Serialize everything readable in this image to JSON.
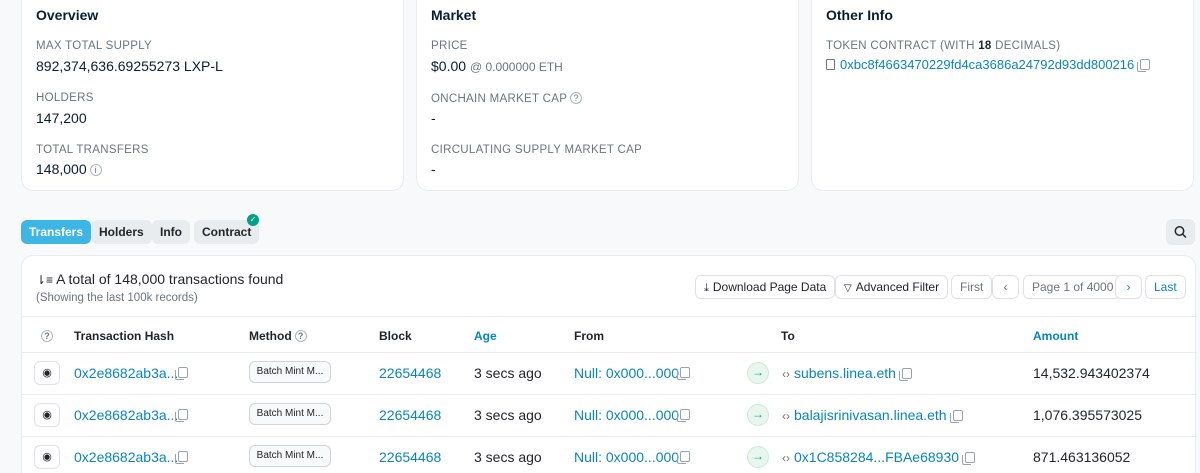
{
  "overview": {
    "title": "Overview",
    "max_supply_label": "MAX TOTAL SUPPLY",
    "max_supply_value": "892,374,636.69255273 LXP-L",
    "holders_label": "HOLDERS",
    "holders_value": "147,200",
    "transfers_label": "TOTAL TRANSFERS",
    "transfers_value": "148,000"
  },
  "market": {
    "title": "Market",
    "price_label": "PRICE",
    "price_value": "$0.00",
    "price_eth": "@ 0.000000 ETH",
    "onchain_cap_label": "ONCHAIN MARKET CAP",
    "onchain_cap_value": "-",
    "circ_cap_label": "CIRCULATING SUPPLY MARKET CAP",
    "circ_cap_value": "-"
  },
  "other_info": {
    "title": "Other Info",
    "contract_label_pre": "TOKEN CONTRACT (WITH ",
    "contract_label_decimals": "18",
    "contract_label_post": " DECIMALS)",
    "contract_address": "0xbc8f4663470229fd4ca3686a24792d93dd800216"
  },
  "tabs": [
    {
      "label": "Transfers",
      "active": true
    },
    {
      "label": "Holders",
      "active": false
    },
    {
      "label": "Info",
      "active": false
    },
    {
      "label": "Contract",
      "active": false
    }
  ],
  "summary": {
    "text": "A total of 148,000 transactions found",
    "sub": "(Showing the last 100k records)"
  },
  "toolbar": {
    "download_label": "Download Page Data",
    "filter_label": "Advanced Filter",
    "first_label": "First",
    "page_label": "Page 1 of 4000",
    "last_label": "Last"
  },
  "columns": {
    "hash": "Transaction Hash",
    "method": "Method",
    "block": "Block",
    "age": "Age",
    "from": "From",
    "to": "To",
    "amount": "Amount"
  },
  "rows": [
    {
      "hash": "0x2e8682ab3a...",
      "method": "Batch Mint M...",
      "block": "22654468",
      "age": "3 secs ago",
      "from": "Null: 0x000...000",
      "to": "subens.linea.eth",
      "amount": "14,532.943402374"
    },
    {
      "hash": "0x2e8682ab3a...",
      "method": "Batch Mint M...",
      "block": "22654468",
      "age": "3 secs ago",
      "from": "Null: 0x000...000",
      "to": "balajisrinivasan.linea.eth",
      "amount": "1,076.395573025"
    },
    {
      "hash": "0x2e8682ab3a...",
      "method": "Batch Mint M...",
      "block": "22654468",
      "age": "3 secs ago",
      "from": "Null: 0x000...000",
      "to": "0x1C858284...FBAe68930",
      "amount": "871.463136052"
    }
  ],
  "colors": {
    "accent": "#0784c3",
    "tab_active": "#3db6e6",
    "success": "#00a186"
  }
}
